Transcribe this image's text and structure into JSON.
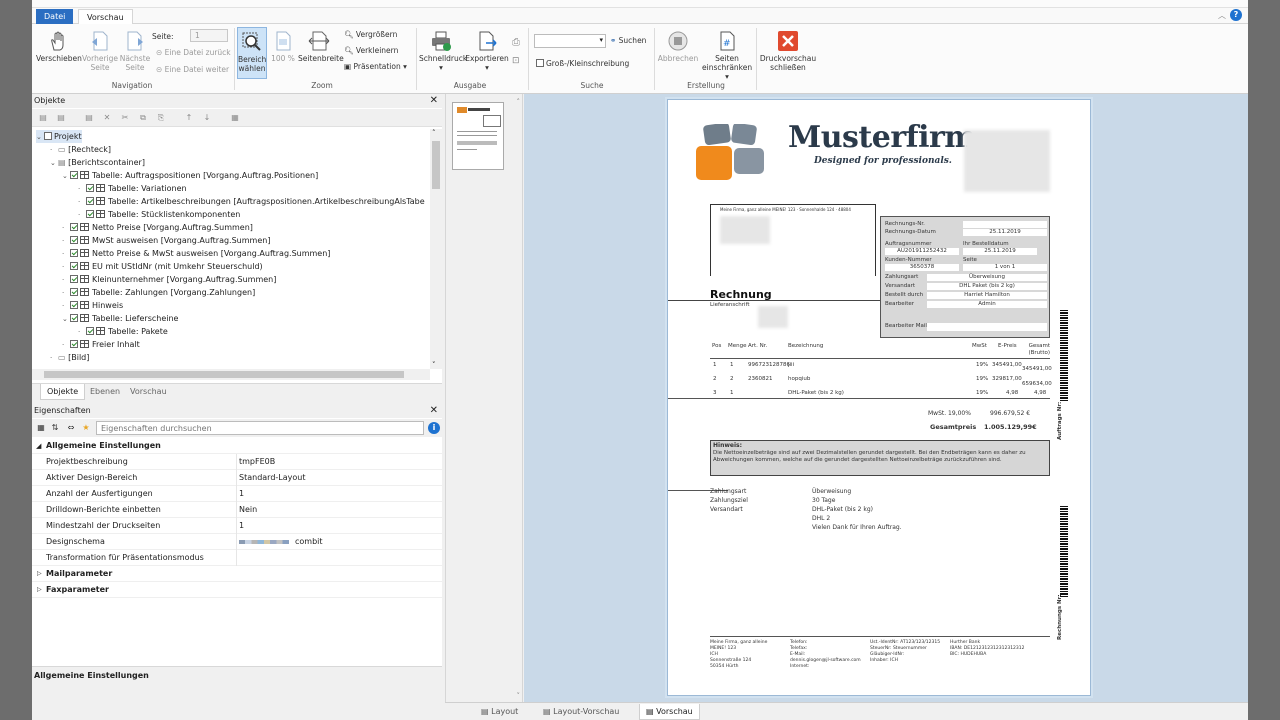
{
  "menu": {
    "tabs": [
      "Datei",
      "Vorschau"
    ]
  },
  "ribbon": {
    "navigation": {
      "verschieben": "Verschieben",
      "vorherige_seite": "Vorherige Seite",
      "naechste_seite": "Nächste Seite",
      "seite_label": "Seite:",
      "seite_value": "1",
      "eine_datei_zurueck": "Eine Datei zurück",
      "eine_datei_weiter": "Eine Datei weiter",
      "group": "Navigation"
    },
    "zoom": {
      "bereich_waehlen": "Bereich wählen",
      "hundert": "100 %",
      "seitenbreite": "Seitenbreite",
      "vergroessern": "Vergrößern",
      "verkleinern": "Verkleinern",
      "praesentation": "Präsentation",
      "group": "Zoom"
    },
    "ausgabe": {
      "schnelldruck": "Schnelldruck",
      "exportieren": "Exportieren",
      "group": "Ausgabe"
    },
    "suche": {
      "suchen": "Suchen",
      "gross_klein": "Groß-/Kleinschreibung",
      "group": "Suche"
    },
    "erstellung": {
      "abbrechen": "Abbrechen",
      "seiten_einschraenken": "Seiten einschränken",
      "group": "Erstellung"
    },
    "schliessen": "Druckvorschau schließen"
  },
  "objekte": {
    "title": "Objekte",
    "tree": [
      "Projekt",
      "[Rechteck]",
      "[Berichtscontainer]",
      "Tabelle: Auftragspositionen [Vorgang.Auftrag.Positionen]",
      "Tabelle: Variationen",
      "Tabelle: Artikelbeschreibungen [Auftragspositionen.ArtikelbeschreibungAlsTabe",
      "Tabelle: Stücklistenkomponenten",
      "Netto Preise [Vorgang.Auftrag.Summen]",
      "MwSt ausweisen [Vorgang.Auftrag.Summen]",
      "Netto Preise & MwSt ausweisen [Vorgang.Auftrag.Summen]",
      "EU mit UStIdNr (mit Umkehr Steuerschuld)",
      "Kleinunternehmer [Vorgang.Auftrag.Summen]",
      "Tabelle: Zahlungen [Vorgang.Zahlungen]",
      "Hinweis",
      "Tabelle: Lieferscheine",
      "Tabelle: Pakete",
      "Freier Inhalt",
      "[Bild]"
    ],
    "tabs": [
      "Objekte",
      "Ebenen",
      "Vorschau"
    ]
  },
  "eigenschaften": {
    "title": "Eigenschaften",
    "search_placeholder": "Eigenschaften durchsuchen",
    "category": "Allgemeine Einstellungen",
    "rows": [
      {
        "key": "Projektbeschreibung",
        "value": "tmpFE0B"
      },
      {
        "key": "Aktiver Design-Bereich",
        "value": "Standard-Layout"
      },
      {
        "key": "Anzahl der Ausfertigungen",
        "value": "1"
      },
      {
        "key": "Drilldown-Berichte einbetten",
        "value": "Nein"
      },
      {
        "key": "Mindestzahl der Druckseiten",
        "value": "1"
      },
      {
        "key": "Designschema",
        "value": "combit"
      },
      {
        "key": "Transformation für Präsentationsmodus",
        "value": ""
      }
    ],
    "categories_collapsed": [
      "Mailparameter",
      "Faxparameter"
    ],
    "description_title": "Allgemeine Einstellungen"
  },
  "view_tabs": [
    "Layout",
    "Layout-Vorschau",
    "Vorschau"
  ],
  "invoice": {
    "logo_text": "Musterfirm",
    "slogan": "Designed for professionals.",
    "sender_line": "Meine Firma, ganz alleine MEINE! 123 · Sonnenhalde 124 · 48804",
    "box": [
      [
        "Rechnungs-Nr.",
        ""
      ],
      [
        "Rechnungs-Datum",
        "25.11.2019"
      ],
      [
        "Auftragsnummer",
        "Ihr Bestelldatum"
      ],
      [
        "AU201911252432",
        "25.11.2019"
      ],
      [
        "Kunden-Nummer",
        "Seite"
      ],
      [
        "3650378",
        "1 von 1"
      ],
      [
        "Zahlungsart",
        "Überweisung"
      ],
      [
        "Versandart",
        "DHL Paket (bis 2 kg)"
      ],
      [
        "Bestellt durch",
        "Harriet Hamilton"
      ],
      [
        "Bearbeiter",
        "Admin"
      ],
      [
        "Bearbeiter Mail",
        ""
      ]
    ],
    "title": "Rechnung",
    "lieferanschrift": "Lieferanschrift",
    "columns": [
      "Pos",
      "Menge",
      "Art. Nr.",
      "Bezeichnung",
      "MwSt",
      "E-Preis",
      "Gesamt (Brutto)"
    ],
    "rows": [
      [
        "1",
        "1",
        "996723128786",
        "jiii",
        "19%",
        "345491,00",
        "345491,00"
      ],
      [
        "2",
        "2",
        "2360821",
        "hopqiub",
        "19%",
        "329817,00",
        "659634,00"
      ],
      [
        "3",
        "1",
        "",
        "DHL-Paket (bis 2 kg)",
        "19%",
        "4,98",
        "4,98"
      ]
    ],
    "mwst_label": "MwSt. 19,00%",
    "mwst_value": "996.679,52 €",
    "gesamt_label": "Gesamtpreis",
    "gesamt_value": "1.005.129,99€",
    "hinweis_title": "Hinweis:",
    "hinweis_text": "Die Nettoeinzelbeträge sind auf zwei Dezimalstellen gerundet dargestellt. Bei den Endbeträgen kann es daher zu Abweichungen kommen, welche auf die gerundet dargestellten Nettoeinzelbeträge zurückzuführen sind.",
    "payment": [
      [
        "Zahlungsart",
        "Überweisung"
      ],
      [
        "Zahlungsziel",
        "30 Tage"
      ],
      [
        "Versandart",
        "DHL-Paket (bis 2 kg)"
      ],
      [
        "",
        "DHL 2"
      ],
      [
        "",
        "Vielen Dank für Ihren Auftrag."
      ]
    ],
    "side_auftrag": "Auftrags Nr:",
    "side_rechnung": "Rechnungs Nr:",
    "footer": [
      "Meine Firma, ganz alleine\nMEINE! 123\nICH\nSonnenstraße 124\n50354 Hürth",
      "Telefon:\nTelefax:\nE-Mail:\ndennis.glogen@jl-software.com\nInternet:",
      "Ust.-IdentNr: AT123/123/12315\nSteuerNr: Steuernummer\nGläubiger-IdNr:\nInhaber: ICH",
      "Hurther Bank\nIBAN: DE1212312312312312312\nBIC: HUDEHUBA"
    ]
  }
}
